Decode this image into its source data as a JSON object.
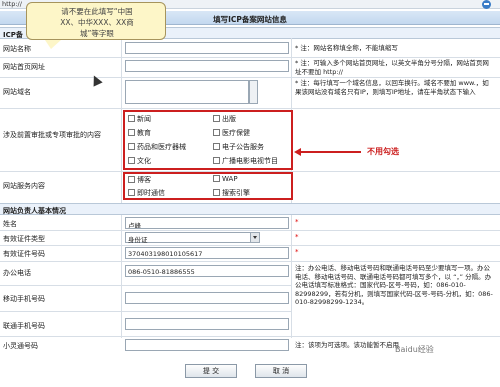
{
  "browser": {
    "address": "http://"
  },
  "callout": {
    "line1": "请不要在此填写“中国",
    "line2": "XX、中华XXX、XX商",
    "line3": "城”等字眼"
  },
  "header": {
    "title": "填写ICP备案网站信息"
  },
  "section1": {
    "label": "ICP备"
  },
  "fields": {
    "site_name": {
      "label": "网站名称",
      "note": "* 注：网站名称填全称，不能填缩写"
    },
    "site_url": {
      "label": "网站首页网址",
      "note": "* 注：可输入多个网站首页网址，以英文半角分号分隔，网站首页网址不要加 http://"
    },
    "domain": {
      "label": "网站域名",
      "note": "* 注：每行填写一个域名信息，以回车换行。域名不要加 www.，如果该网站没有域名只有IP，则填写IP地址，请在半角状态下输入"
    },
    "special": {
      "label": "涉及前置审批或专项审批的内容"
    },
    "service": {
      "label": "网站服务内容"
    }
  },
  "checkboxes": {
    "group1": [
      "新闻",
      "出版",
      "教育",
      "医疗保健",
      "药品和医疗器械",
      "电子公告服务",
      "文化",
      "广播电影电视节目"
    ],
    "group2": [
      "博客",
      "WAP",
      "即时通信",
      "搜索引擎"
    ]
  },
  "annotation": {
    "no_check": "不用勾选"
  },
  "section2": {
    "label": "网站负责人基本情况"
  },
  "person": {
    "name": {
      "label": "姓名",
      "value": "卢峰"
    },
    "id_type": {
      "label": "有效证件类型",
      "value": "身份证"
    },
    "id_no": {
      "label": "有效证件号码",
      "value": "370403198010105617"
    },
    "office_phone": {
      "label": "办公电话",
      "value": "086-0510-81886555",
      "note": "注：办公电话、移动电话号码和联通电话号码至少要填写一项。办公电话、移动电话号码、联通电话号码都可填写多个，以 “，” 分隔。办公电话填写标准格式：国家代码-区号-号码，如：086-010-82998299，若有分机，则填写国家代码-区号-号码-分机，如：086-010-82998299-1234。"
    },
    "mobile": {
      "label": "移动手机号码"
    },
    "unicom": {
      "label": "联通手机号码"
    },
    "phs": {
      "label": "小灵通号码",
      "note": "注：该项为可选项。该功能暂不启用"
    }
  },
  "buttons": {
    "submit": "提 交",
    "cancel": "取 消"
  },
  "watermark": "Baidu经验"
}
